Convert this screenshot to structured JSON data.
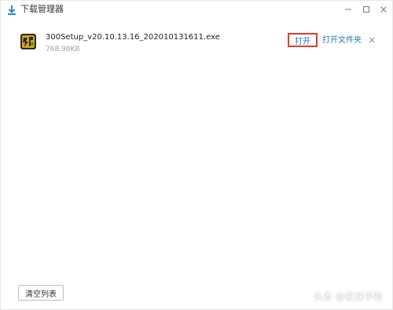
{
  "window": {
    "title": "下载管理器",
    "controls": [
      "minimize-icon",
      "maximize-icon",
      "close-icon"
    ]
  },
  "downloads": [
    {
      "file_name": "300Setup_v20.10.13.16_202010131611.exe",
      "size": "768.98KB",
      "open_label": "打开",
      "open_folder_label": "打开文件夹",
      "icon": "app-file-icon"
    }
  ],
  "footer": {
    "clear_label": "清空列表"
  },
  "watermark": {
    "text": "头条 @极速手助"
  },
  "colors": {
    "accent_link": "#2a7ab8",
    "highlight_border": "#e23b2f",
    "title_icon": "#2b8ad6"
  }
}
